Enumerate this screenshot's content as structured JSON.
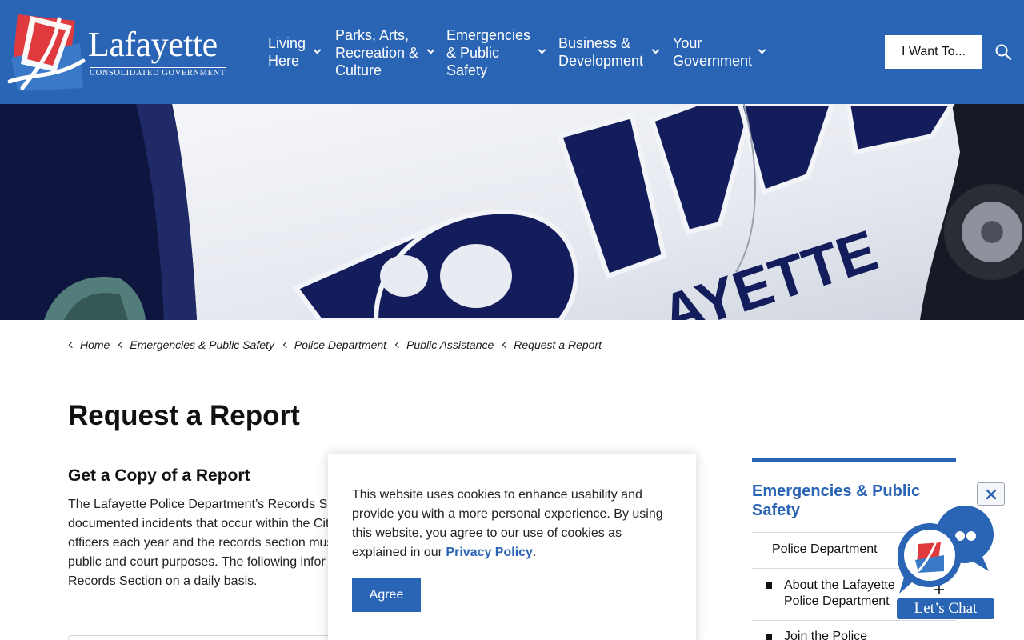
{
  "logo": {
    "name": "Lafayette",
    "subtitle": "CONSOLIDATED GOVERNMENT"
  },
  "nav": {
    "items": [
      {
        "line1": "Living",
        "line2": "Here",
        "line3": ""
      },
      {
        "line1": "Parks, Arts,",
        "line2": "Recreation &",
        "line3": "Culture"
      },
      {
        "line1": "Emergencies",
        "line2": "& Public",
        "line3": "Safety"
      },
      {
        "line1": "Business &",
        "line2": "Development",
        "line3": ""
      },
      {
        "line1": "Your",
        "line2": "Government",
        "line3": ""
      }
    ],
    "cta_label": "I Want To..."
  },
  "hero": {
    "decal_text": "POLICE",
    "decal_sub": "AYETTE"
  },
  "breadcrumb": [
    "Home",
    "Emergencies & Public Safety",
    "Police Department",
    "Public Assistance",
    "Request a Report"
  ],
  "page": {
    "title": "Request a Report",
    "section_heading": "Get a Copy of a Report",
    "body_lines": [
      "The Lafayette Police Department’s Records Se",
      "documented incidents that occur within the Cit",
      "officers each year and the records section mus",
      "public and court purposes. The following infor",
      "Records Section on a daily basis."
    ]
  },
  "sidebar": {
    "title_line1": "Emergencies & Public",
    "title_line2": "Safety",
    "links": [
      {
        "line1": "Police Department",
        "line2": ""
      },
      {
        "line1": "About the Lafayette",
        "line2": "Police Department"
      },
      {
        "line1": "Join the Police",
        "line2": ""
      }
    ]
  },
  "cookie": {
    "text_before": "This website uses cookies to enhance usability and provide you with a more personal experience. By using this website, you agree to our use of cookies as explained in our ",
    "link_text": "Privacy Policy",
    "text_after": ".",
    "agree_label": "Agree"
  },
  "chat": {
    "label": "Let’s Chat",
    "close_symbol": "✕"
  },
  "colors": {
    "brand_blue": "#2a64b4",
    "logo_red": "#e03a3e",
    "police_navy": "#141d5c"
  }
}
